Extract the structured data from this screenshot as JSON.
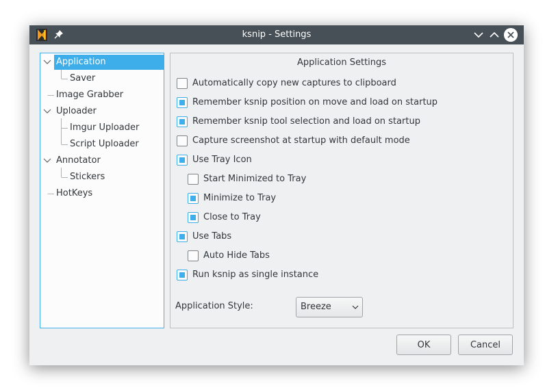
{
  "window": {
    "title": "ksnip - Settings"
  },
  "titlebar": {
    "icons": [
      "ksnip-logo-icon",
      "pin-icon",
      "minimize-chevron-icon",
      "maximize-chevron-icon",
      "close-icon"
    ]
  },
  "tree": {
    "items": [
      {
        "label": "Application",
        "selected": true,
        "expandable": true
      },
      {
        "label": "Saver"
      },
      {
        "label": "Image Grabber"
      },
      {
        "label": "Uploader",
        "expandable": true
      },
      {
        "label": "Imgur Uploader"
      },
      {
        "label": "Script Uploader"
      },
      {
        "label": "Annotator",
        "expandable": true
      },
      {
        "label": "Stickers"
      },
      {
        "label": "HotKeys"
      }
    ]
  },
  "settings": {
    "title": "Application Settings",
    "options": [
      {
        "label": "Automatically copy new captures to clipboard",
        "checked": false
      },
      {
        "label": "Remember ksnip position on move and load on startup",
        "checked": true
      },
      {
        "label": "Remember ksnip tool selection and load on startup",
        "checked": true
      },
      {
        "label": "Capture screenshot at startup with default mode",
        "checked": false
      },
      {
        "label": "Use Tray Icon",
        "checked": true
      },
      {
        "label": "Start Minimized to Tray",
        "checked": false
      },
      {
        "label": "Minimize to Tray",
        "checked": true
      },
      {
        "label": "Close to Tray",
        "checked": true
      },
      {
        "label": "Use Tabs",
        "checked": true
      },
      {
        "label": "Auto Hide Tabs",
        "checked": false
      },
      {
        "label": "Run ksnip as single instance",
        "checked": true
      }
    ],
    "style_label": "Application Style:",
    "style_value": "Breeze"
  },
  "buttons": {
    "ok": "OK",
    "cancel": "Cancel"
  },
  "colors": {
    "accent": "#3daee9",
    "titlebar": "#475057",
    "window_bg": "#eff0f1"
  }
}
